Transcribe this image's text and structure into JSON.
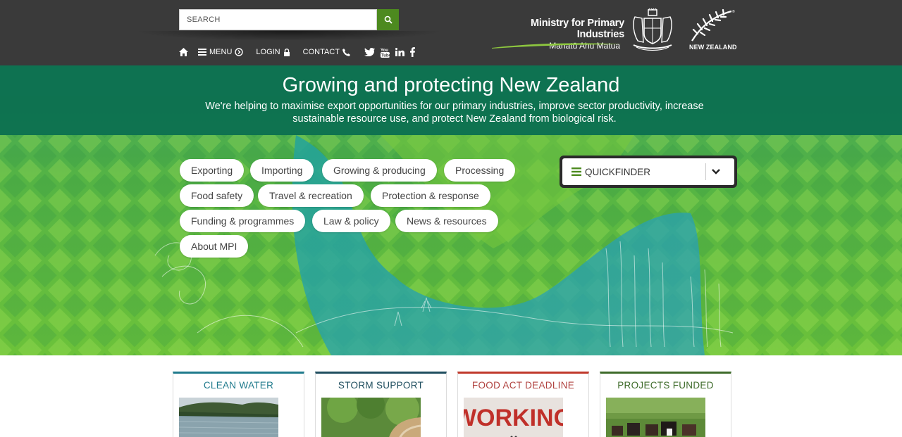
{
  "header": {
    "search_placeholder": "SEARCH",
    "nav": [
      {
        "label": "",
        "icon": "home-icon"
      },
      {
        "label": "MENU",
        "icon": "menu-icon"
      },
      {
        "label": "LOGIN",
        "icon": "lock-icon"
      },
      {
        "label": "CONTACT",
        "icon": "phone-icon"
      }
    ],
    "social": [
      "twitter-icon",
      "youtube-icon",
      "linkedin-icon",
      "facebook-icon"
    ],
    "ministry_name": "Ministry for Primary Industries",
    "ministry_maori": "Manatū Ahu Matua",
    "nz_logo_text": "NEW ZEALAND",
    "tm": "®"
  },
  "hero": {
    "title": "Growing and protecting New Zealand",
    "subtitle": "We're helping to maximise export opportunities for our primary industries, improve sector productivity, increase sustainable resource use, and protect New Zealand from biological risk.",
    "topics": [
      "Exporting",
      "Importing",
      "Growing & producing",
      "Processing",
      "Food safety",
      "Travel & recreation",
      "Protection & response",
      "Funding & programmes",
      "Law & policy",
      "News & resources",
      "About MPI"
    ],
    "quickfinder_label": "QUICKFINDER"
  },
  "cards": [
    {
      "title": "CLEAN WATER",
      "color": "#1f7a8c"
    },
    {
      "title": "STORM SUPPORT",
      "color": "#1f4e5f"
    },
    {
      "title": "FOOD ACT DEADLINE",
      "color": "#c0392b",
      "image_text": "WORKING"
    },
    {
      "title": "PROJECTS FUNDED",
      "color": "#3e6b2a"
    }
  ],
  "colors": {
    "header_bg": "#3a3a3a",
    "search_button": "#4d8a1f",
    "hero_band": "#0a6e50"
  }
}
